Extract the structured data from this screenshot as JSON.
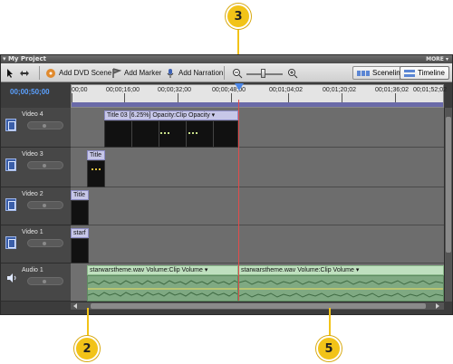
{
  "window": {
    "title": "My Project",
    "more_label": "MORE"
  },
  "toolbar": {
    "add_dvd_scene": "Add DVD Scene",
    "add_marker": "Add Marker",
    "add_narration": "Add Narration",
    "sceneline": "Sceneline",
    "timeline": "Timeline",
    "active_view": "Timeline"
  },
  "ruler": {
    "current_time": "00;00;50;00",
    "labels": [
      "00;00",
      "00;00;16;00",
      "00;00;32;00",
      "00;00;48;00",
      "00;01;04;02",
      "00;01;20;02",
      "00;01;36;02",
      "00;01;52;02"
    ]
  },
  "tracks": {
    "video4": {
      "name": "Video 4",
      "clip_label": "Title 03 [6.25%]  Opacity:Clip Opacity ▾"
    },
    "video3": {
      "name": "Video 3",
      "clip_label": "Title"
    },
    "video2": {
      "name": "Video 2",
      "clip_label": "Title"
    },
    "video1": {
      "name": "Video 1",
      "clip_label": "starf"
    },
    "audio1": {
      "name": "Audio 1",
      "clip1_label": "starwarstheme.wav  Volume:Clip Volume ▾",
      "clip2_label": "starwarstheme.wav  Volume:Clip Volume ▾"
    }
  },
  "callouts": [
    "3",
    "2",
    "5"
  ],
  "colors": {
    "callout": "#f2c318",
    "playhead": "#e24b4b",
    "timecode": "#5aa0ff"
  }
}
